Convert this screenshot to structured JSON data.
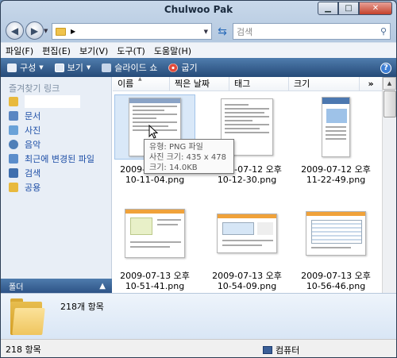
{
  "window": {
    "title": "Chulwoo Pak"
  },
  "address": {
    "search_placeholder": "검색"
  },
  "menu": [
    "파일(F)",
    "편집(E)",
    "보기(V)",
    "도구(T)",
    "도움말(H)"
  ],
  "toolbar": {
    "organize": "구성",
    "views": "보기",
    "slideshow": "슬라이드 쇼",
    "burn": "굽기"
  },
  "sidebar": {
    "title": "즐겨찾기 링크",
    "items": [
      "",
      "문서",
      "사진",
      "음악",
      "최근에 변경된 파일",
      "검색",
      "공용"
    ],
    "folders": "폴더"
  },
  "columns": [
    "이름",
    "찍은 날짜",
    "태그",
    "크기"
  ],
  "columns_more": "»",
  "files": [
    {
      "line1": "2009-07-12 오후",
      "line2": "10-11-04.png"
    },
    {
      "line1": "2009-07-12 오후",
      "line2": "10-12-30.png"
    },
    {
      "line1": "2009-07-12 오후",
      "line2": "11-22-49.png"
    },
    {
      "line1": "2009-07-13 오후",
      "line2": "10-51-41.png"
    },
    {
      "line1": "2009-07-13 오후",
      "line2": "10-54-09.png"
    },
    {
      "line1": "2009-07-13 오후",
      "line2": "10-56-46.png"
    }
  ],
  "tooltip": {
    "type": "유형: PNG 파일",
    "dims": "사진 크기: 435 x 478",
    "size": "크기: 14.0KB"
  },
  "details": {
    "count": "218개 항목"
  },
  "status": {
    "left": "218 항목",
    "right": "컴퓨터"
  }
}
